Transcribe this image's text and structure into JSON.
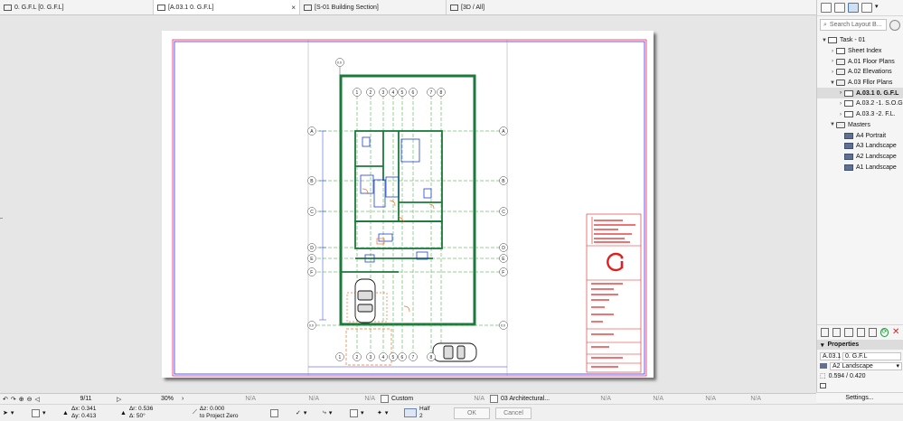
{
  "tabs": [
    {
      "label": "0. G.F.L [0. G.F.L]",
      "active": false
    },
    {
      "label": "[A.03.1 0. G.F.L]",
      "active": true,
      "close": "×"
    },
    {
      "label": "[S-01 Building Section]",
      "active": false
    },
    {
      "label": "[3D / All]",
      "active": false
    }
  ],
  "navigator": {
    "search_placeholder": "Search Layout B...",
    "tree": [
      {
        "label": "Task - 01",
        "level": 0,
        "arrow": "▼",
        "icon": "book"
      },
      {
        "label": "Sheet Index",
        "level": 1,
        "arrow": "›",
        "icon": "doc"
      },
      {
        "label": "A.01 Floor Plans",
        "level": 1,
        "arrow": "›",
        "icon": "folder"
      },
      {
        "label": "A.02 Elevations",
        "level": 1,
        "arrow": "›",
        "icon": "folder"
      },
      {
        "label": "A.03 Fllor Plans",
        "level": 1,
        "arrow": "▼",
        "icon": "folder"
      },
      {
        "label": "A.03.1 0. G.F.L",
        "level": 2,
        "arrow": "›",
        "icon": "layout",
        "selected": true
      },
      {
        "label": "A.03.2 -1. S.O.G",
        "level": 2,
        "arrow": "›",
        "icon": "layout"
      },
      {
        "label": "A.03.3 -2. F.L.",
        "level": 2,
        "arrow": "›",
        "icon": "layout"
      },
      {
        "label": "Masters",
        "level": 1,
        "arrow": "▼",
        "icon": "folder"
      },
      {
        "label": "A4 Portrait",
        "level": 2,
        "arrow": "",
        "icon": "master"
      },
      {
        "label": "A3 Landscape",
        "level": 2,
        "arrow": "",
        "icon": "master"
      },
      {
        "label": "A2 Landscape",
        "level": 2,
        "arrow": "",
        "icon": "master"
      },
      {
        "label": "A1 Landscape",
        "level": 2,
        "arrow": "",
        "icon": "master"
      }
    ],
    "properties_label": "Properties",
    "prop_id": "A.03.1",
    "prop_name": "0. G.F.L",
    "prop_master": "A2 Landscape",
    "prop_size": "0.594 / 0.420",
    "settings_label": "Settings..."
  },
  "statusbar": {
    "page": "9/11",
    "zoom": "30%",
    "na": "N/A",
    "pen_set": "Custom",
    "layer_combo": "03 Architectural...",
    "half_label": "Half",
    "half_value": "2",
    "ok": "OK",
    "cancel": "Cancel",
    "dx": "Δx: 0.341",
    "dy": "Δy: 0.413",
    "dr": "Δr: 0.536",
    "da": "Δ: 50°",
    "dz": "Δz: 0.000",
    "to_project_zero": "to Project Zero"
  },
  "drawing": {
    "grid_top_labels": [
      "1",
      "2",
      "3",
      "4",
      "5",
      "6",
      "7",
      "8"
    ],
    "grid_bottom_labels": [
      "1",
      "2",
      "3",
      "4",
      "5",
      "6",
      "7",
      "8"
    ],
    "grid_side_labels": [
      "A",
      "B",
      "C",
      "D",
      "E",
      "F"
    ],
    "top_marker": "0.0",
    "bottom_left_marker": "0.0",
    "bottom_right_marker": "0.0",
    "colors": {
      "wall": "#1a7a3a",
      "grid": "#2aa02a",
      "blue": "#2040d0",
      "red": "#e02020",
      "orange": "#f07030",
      "border_red": "#ff2060",
      "border_blue": "#3030ff"
    }
  }
}
